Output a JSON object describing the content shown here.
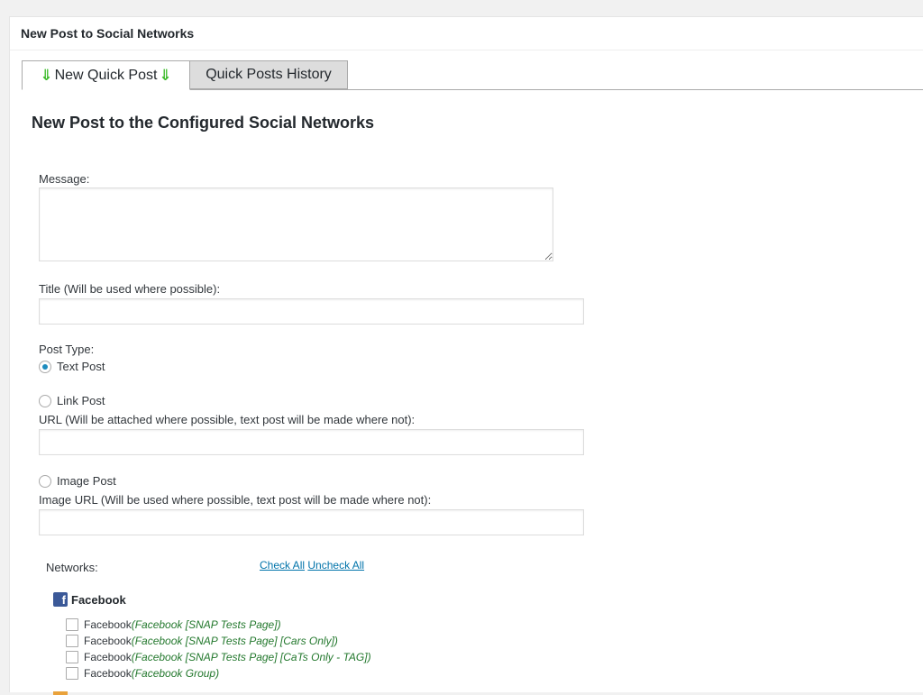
{
  "panel": {
    "title": "New Post to Social Networks"
  },
  "tabs": [
    {
      "label": "New Quick Post",
      "active": true,
      "arrow_icon": "down-double-arrow-icon"
    },
    {
      "label": "Quick Posts History",
      "active": false
    }
  ],
  "form": {
    "heading": "New Post to the Configured Social Networks",
    "message_label": "Message:",
    "message_value": "",
    "title_label": "Title (Will be used where possible):",
    "title_value": "",
    "post_type_label": "Post Type:",
    "post_types": [
      {
        "label": "Text Post",
        "checked": true
      },
      {
        "label": "Link Post",
        "checked": false
      },
      {
        "label": "Image Post",
        "checked": false
      }
    ],
    "url_label": "URL (Will be attached where possible, text post will be made where not):",
    "url_value": "",
    "image_url_label": "Image URL (Will be used where possible, text post will be made where not):",
    "image_url_value": ""
  },
  "networks": {
    "label": "Networks:",
    "check_all": "Check All",
    "uncheck_all": "Uncheck All",
    "facebook": {
      "label": "Facebook",
      "icon": "facebook-icon",
      "accounts": [
        {
          "name": "Facebook",
          "detail": "(Facebook [SNAP Tests Page])",
          "checked": false
        },
        {
          "name": "Facebook",
          "detail": "(Facebook [SNAP Tests Page] [Cars Only])",
          "checked": false
        },
        {
          "name": "Facebook",
          "detail": "(Facebook [SNAP Tests Page] [CaTs Only - TAG])",
          "checked": false
        },
        {
          "name": "Facebook",
          "detail": "(Facebook Group)",
          "checked": false
        }
      ]
    }
  },
  "colors": {
    "accent": "#0073aa",
    "arrow": "#3cbb2a",
    "account_detail": "#23782d",
    "facebook": "#3b5998"
  }
}
